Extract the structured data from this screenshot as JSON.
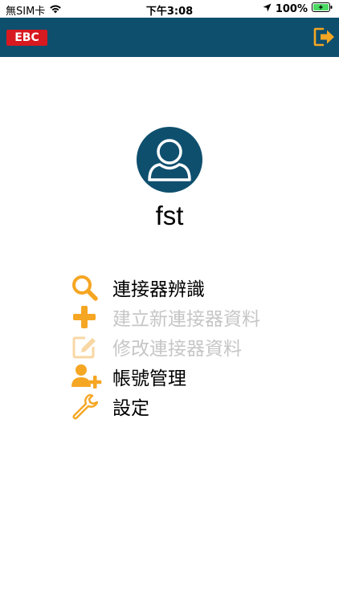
{
  "status_bar": {
    "carrier": "無SIM卡",
    "time": "下午3:08",
    "battery": "100%"
  },
  "app_bar": {
    "logo_text": "EBC",
    "logout_icon": "logout-arrow-icon"
  },
  "profile": {
    "username": "fst",
    "avatar_icon": "user-avatar-icon"
  },
  "menu": {
    "items": [
      {
        "label": "連接器辨識",
        "icon": "search-icon",
        "enabled": true
      },
      {
        "label": "建立新連接器資料",
        "icon": "plus-icon",
        "enabled": false
      },
      {
        "label": "修改連接器資料",
        "icon": "edit-icon",
        "enabled": false
      },
      {
        "label": "帳號管理",
        "icon": "add-user-icon",
        "enabled": true
      },
      {
        "label": "設定",
        "icon": "wrench-icon",
        "enabled": true
      }
    ]
  },
  "colors": {
    "app_bar": "#0e4f6e",
    "accent": "#f5a623",
    "accent_disabled": "#f8d7a4",
    "logo_red": "#d71920"
  }
}
